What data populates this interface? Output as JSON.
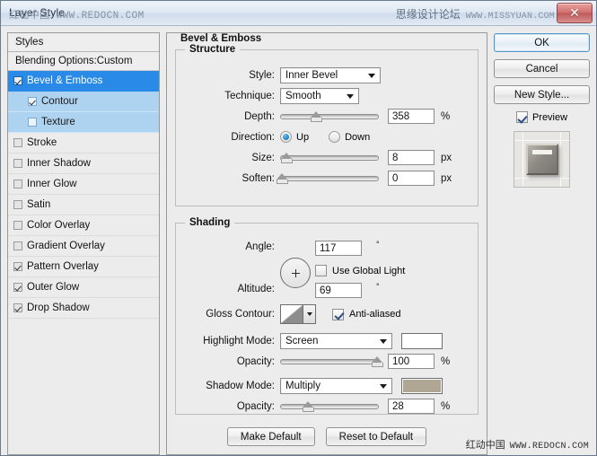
{
  "window": {
    "title": "Layer Style",
    "close_label": "✕",
    "watermark_title_left": "红动中国 WWW.REDOCN.COM",
    "watermark_title_right_cn": "思缘设计论坛",
    "watermark_title_right_url": "WWW.MISSYUAN.COM",
    "watermark_bottom_cn": "红动中国",
    "watermark_bottom_url": "WWW.REDOCN.COM"
  },
  "styles_panel": {
    "header": "Styles",
    "blending_options": "Blending Options:Custom",
    "items": [
      {
        "label": "Bevel & Emboss",
        "checked": true,
        "selected": true,
        "sub": false
      },
      {
        "label": "Contour",
        "checked": true,
        "selected": false,
        "sub": true
      },
      {
        "label": "Texture",
        "checked": false,
        "selected": false,
        "sub": true
      },
      {
        "label": "Stroke",
        "checked": false,
        "selected": false,
        "sub": false
      },
      {
        "label": "Inner Shadow",
        "checked": false,
        "selected": false,
        "sub": false
      },
      {
        "label": "Inner Glow",
        "checked": false,
        "selected": false,
        "sub": false
      },
      {
        "label": "Satin",
        "checked": false,
        "selected": false,
        "sub": false
      },
      {
        "label": "Color Overlay",
        "checked": false,
        "selected": false,
        "sub": false
      },
      {
        "label": "Gradient Overlay",
        "checked": false,
        "selected": false,
        "sub": false
      },
      {
        "label": "Pattern Overlay",
        "checked": true,
        "selected": false,
        "sub": false
      },
      {
        "label": "Outer Glow",
        "checked": true,
        "selected": false,
        "sub": false
      },
      {
        "label": "Drop Shadow",
        "checked": true,
        "selected": false,
        "sub": false
      }
    ]
  },
  "main": {
    "section_title": "Bevel & Emboss",
    "structure": {
      "legend": "Structure",
      "style_label": "Style:",
      "style_value": "Inner Bevel",
      "technique_label": "Technique:",
      "technique_value": "Smooth",
      "depth_label": "Depth:",
      "depth_value": "358",
      "depth_unit": "%",
      "depth_percent": 36,
      "direction_label": "Direction:",
      "direction_up": "Up",
      "direction_down": "Down",
      "direction_selected": "Up",
      "size_label": "Size:",
      "size_value": "8",
      "size_unit": "px",
      "size_percent": 6,
      "soften_label": "Soften:",
      "soften_value": "0",
      "soften_unit": "px",
      "soften_percent": 2
    },
    "shading": {
      "legend": "Shading",
      "angle_label": "Angle:",
      "angle_value": "117",
      "angle_unit": "°",
      "global_light_label": "Use Global Light",
      "global_light_checked": false,
      "altitude_label": "Altitude:",
      "altitude_value": "69",
      "altitude_unit": "°",
      "gloss_contour_label": "Gloss Contour:",
      "anti_aliased_label": "Anti-aliased",
      "anti_aliased_checked": true,
      "highlight_mode_label": "Highlight Mode:",
      "highlight_mode_value": "Screen",
      "highlight_color": "#ffffff",
      "highlight_opacity_label": "Opacity:",
      "highlight_opacity_value": "100",
      "highlight_opacity_unit": "%",
      "highlight_opacity_percent": 100,
      "shadow_mode_label": "Shadow Mode:",
      "shadow_mode_value": "Multiply",
      "shadow_color": "#b0a694",
      "shadow_opacity_label": "Opacity:",
      "shadow_opacity_value": "28",
      "shadow_opacity_unit": "%",
      "shadow_opacity_percent": 28
    },
    "make_default": "Make Default",
    "reset_to_default": "Reset to Default"
  },
  "buttons": {
    "ok": "OK",
    "cancel": "Cancel",
    "new_style": "New Style...",
    "preview": "Preview",
    "preview_checked": true
  }
}
